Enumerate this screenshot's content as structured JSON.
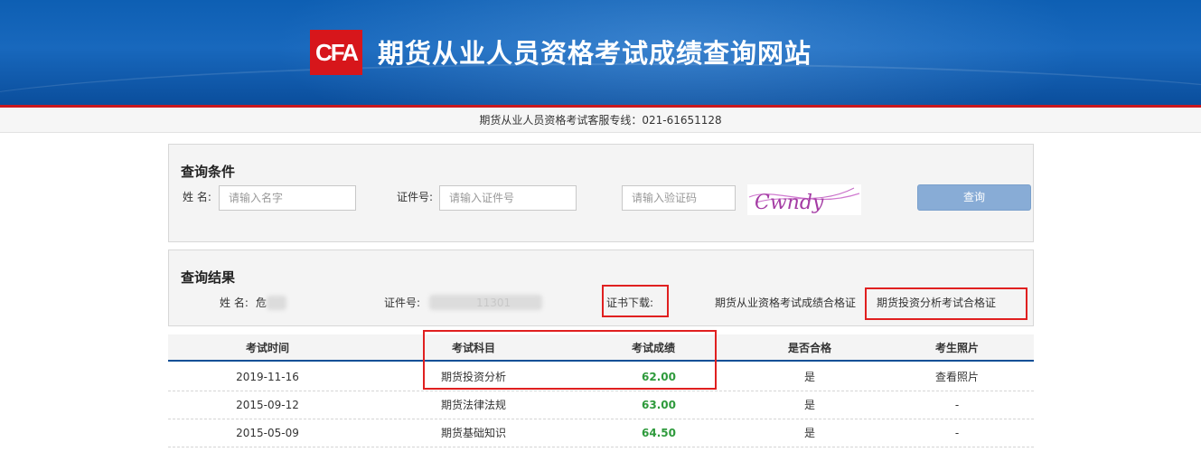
{
  "header": {
    "logo_text": "CFA",
    "title": "期货从业人员资格考试成绩查询网站",
    "hotline": "期货从业人员资格考试客服专线：021-61651128"
  },
  "query": {
    "title": "查询条件",
    "name_label": "姓 名:",
    "name_placeholder": "请输入名字",
    "id_label": "证件号:",
    "id_placeholder": "请输入证件号",
    "captcha_placeholder": "请输入验证码",
    "captcha_text": "Cwndy",
    "button": "查询"
  },
  "result": {
    "title": "查询结果",
    "name_label": "姓 名:",
    "name_value": "危",
    "id_label": "证件号:",
    "id_value_partial": "11301",
    "cert_label": "证书下载:",
    "cert_link_1": "期货从业资格考试成绩合格证",
    "cert_link_2": "期货投资分析考试合格证"
  },
  "table": {
    "headers": [
      "考试时间",
      "考试科目",
      "考试成绩",
      "是否合格",
      "考生照片"
    ],
    "rows": [
      {
        "date": "2019-11-16",
        "subject": "期货投资分析",
        "score": "62.00",
        "pass": "是",
        "photo": "查看照片"
      },
      {
        "date": "2015-09-12",
        "subject": "期货法律法规",
        "score": "63.00",
        "pass": "是",
        "photo": "-"
      },
      {
        "date": "2015-05-09",
        "subject": "期货基础知识",
        "score": "64.50",
        "pass": "是",
        "photo": "-"
      }
    ]
  },
  "colors": {
    "banner": "#1565b8",
    "accent_red": "#c9181e",
    "score_green": "#2e9a3c",
    "button": "#88acd6",
    "annotation": "#e02020"
  }
}
